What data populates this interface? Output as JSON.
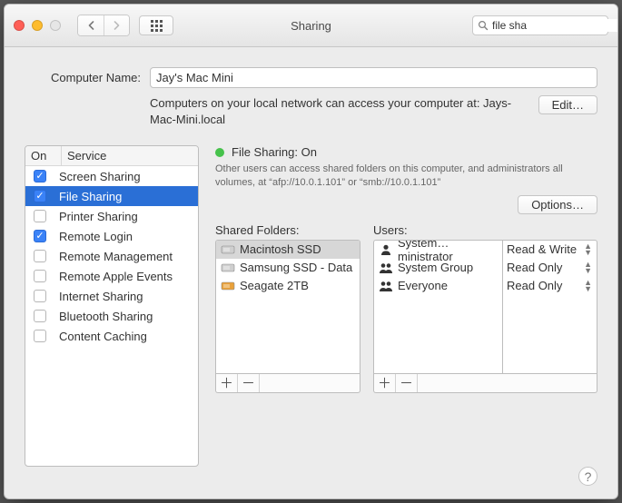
{
  "window_title": "Sharing",
  "search": {
    "value": "file sha"
  },
  "computer_name": {
    "label": "Computer Name:",
    "value": "Jay's Mac Mini"
  },
  "subtext": "Computers on your local network can access your computer at: Jays-Mac-Mini.local",
  "edit_button": "Edit…",
  "services_header": {
    "on": "On",
    "service": "Service"
  },
  "services": [
    {
      "label": "Screen Sharing",
      "on": true,
      "sel": false
    },
    {
      "label": "File Sharing",
      "on": true,
      "sel": true
    },
    {
      "label": "Printer Sharing",
      "on": false,
      "sel": false
    },
    {
      "label": "Remote Login",
      "on": true,
      "sel": false
    },
    {
      "label": "Remote Management",
      "on": false,
      "sel": false
    },
    {
      "label": "Remote Apple Events",
      "on": false,
      "sel": false
    },
    {
      "label": "Internet Sharing",
      "on": false,
      "sel": false
    },
    {
      "label": "Bluetooth Sharing",
      "on": false,
      "sel": false
    },
    {
      "label": "Content Caching",
      "on": false,
      "sel": false
    }
  ],
  "status": {
    "label": "File Sharing: On"
  },
  "status_desc": "Other users can access shared folders on this computer, and administrators all volumes, at “afp://10.0.1.101” or “smb://10.0.1.101”",
  "options_button": "Options…",
  "shared_folders": {
    "title": "Shared Folders:",
    "items": [
      {
        "label": "Macintosh SSD",
        "sel": true,
        "icon": "ssd"
      },
      {
        "label": "Samsung SSD - Data",
        "sel": false,
        "icon": "ssd"
      },
      {
        "label": "Seagate 2TB",
        "sel": false,
        "icon": "hdd"
      }
    ]
  },
  "users": {
    "title": "Users:",
    "items": [
      {
        "label": "System…ministrator",
        "perm": "Read & Write",
        "icon": "person"
      },
      {
        "label": "System Group",
        "perm": "Read Only",
        "icon": "group"
      },
      {
        "label": "Everyone",
        "perm": "Read Only",
        "icon": "group"
      }
    ]
  }
}
